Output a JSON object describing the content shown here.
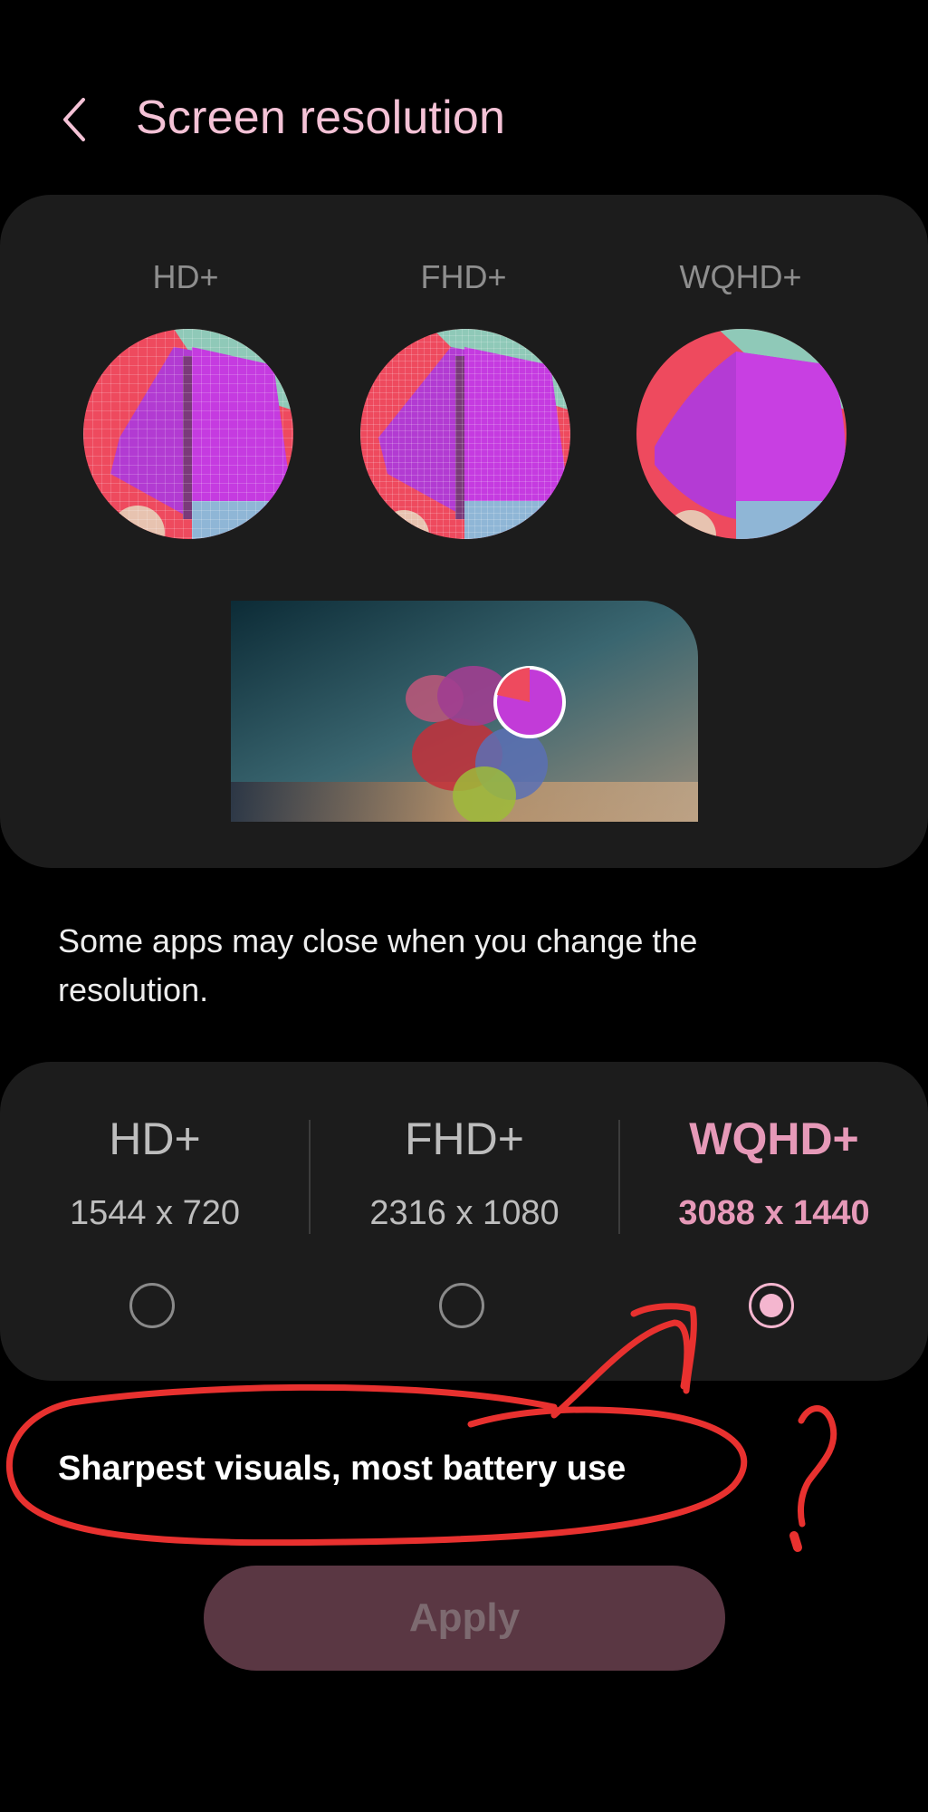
{
  "header": {
    "title": "Screen resolution"
  },
  "preview": {
    "labels": [
      "HD+",
      "FHD+",
      "WQHD+"
    ]
  },
  "note": "Some apps may close when you change the resolution.",
  "options": [
    {
      "name": "HD+",
      "resolution": "1544 x 720",
      "selected": false
    },
    {
      "name": "FHD+",
      "resolution": "2316 x 1080",
      "selected": false
    },
    {
      "name": "WQHD+",
      "resolution": "3088 x 1440",
      "selected": true
    }
  ],
  "description": "Sharpest visuals, most battery use",
  "apply_label": "Apply",
  "annotation": {
    "mark": "?",
    "color": "#e8312f"
  },
  "colors": {
    "accent": "#f4b6cf",
    "title": "#f4c2d6",
    "card": "#1c1c1c",
    "apply_bg": "#5a3743"
  }
}
